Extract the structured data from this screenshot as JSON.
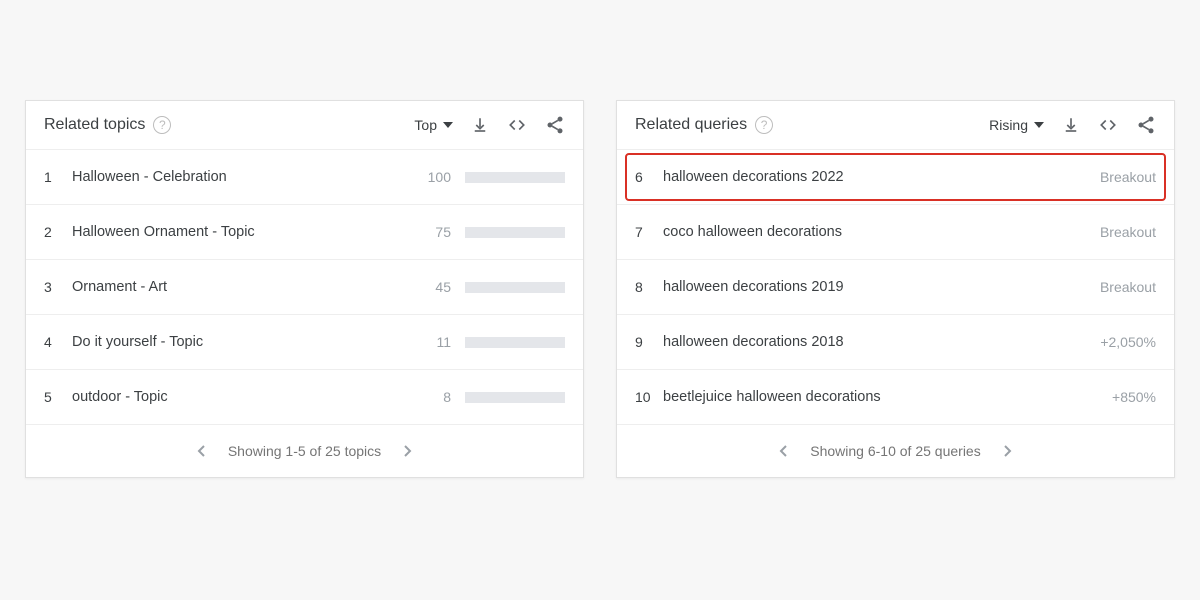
{
  "left": {
    "title": "Related topics",
    "sort": "Top",
    "items": [
      {
        "rank": "1",
        "label": "Halloween - Celebration",
        "value": "100",
        "bar": 100
      },
      {
        "rank": "2",
        "label": "Halloween Ornament - Topic",
        "value": "75",
        "bar": 75
      },
      {
        "rank": "3",
        "label": "Ornament - Art",
        "value": "45",
        "bar": 45
      },
      {
        "rank": "4",
        "label": "Do it yourself - Topic",
        "value": "11",
        "bar": 11
      },
      {
        "rank": "5",
        "label": "outdoor - Topic",
        "value": "8",
        "bar": 8
      }
    ],
    "pager": "Showing 1-5 of 25 topics"
  },
  "right": {
    "title": "Related queries",
    "sort": "Rising",
    "items": [
      {
        "rank": "6",
        "label": "halloween decorations 2022",
        "metric": "Breakout",
        "highlight": true
      },
      {
        "rank": "7",
        "label": "coco halloween decorations",
        "metric": "Breakout"
      },
      {
        "rank": "8",
        "label": "halloween decorations 2019",
        "metric": "Breakout"
      },
      {
        "rank": "9",
        "label": "halloween decorations 2018",
        "metric": "+2,050%"
      },
      {
        "rank": "10",
        "label": "beetlejuice halloween decorations",
        "metric": "+850%"
      }
    ],
    "pager": "Showing 6-10 of 25 queries"
  }
}
